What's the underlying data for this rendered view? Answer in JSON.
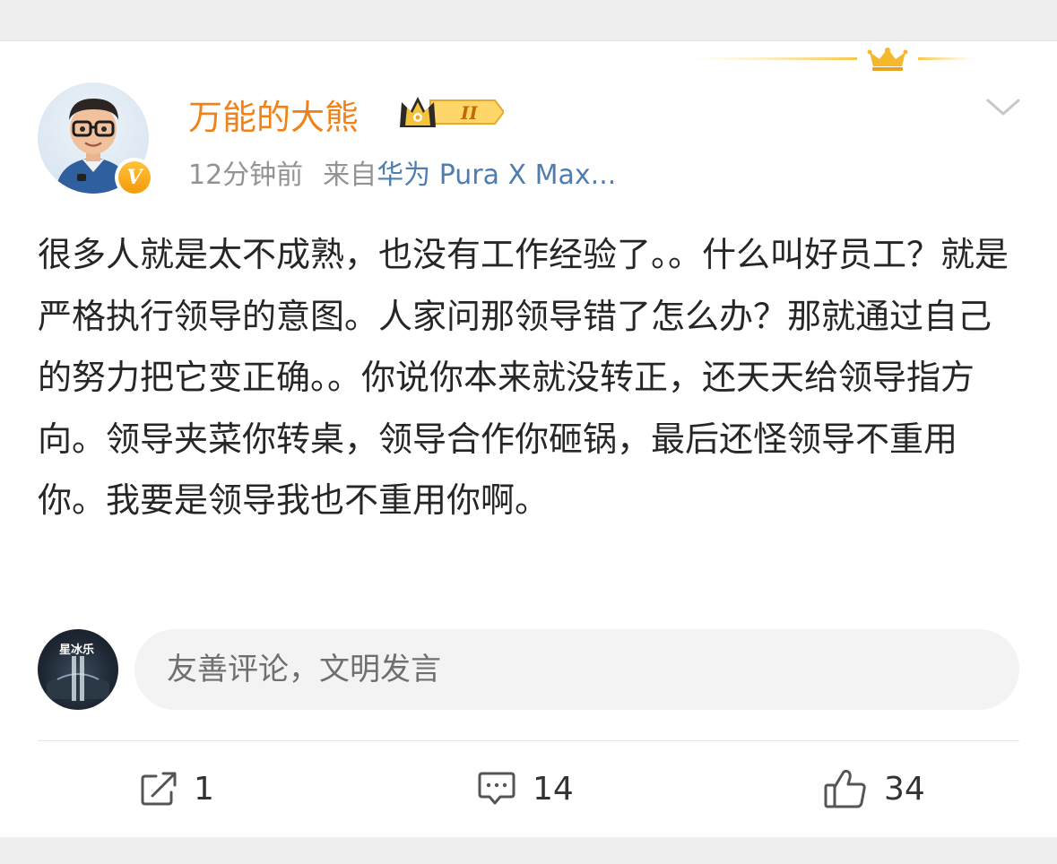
{
  "post": {
    "author": "万能的大熊",
    "level_badge": "II",
    "time": "12分钟前",
    "source_prefix": "来自",
    "device": "华为 Pura X Max...",
    "vip_mark": "V",
    "text": "很多人就是太不成熟，也没有工作经验了。。什么叫好员工？就是严格执行领导的意图。人家问那领导错了怎么办？那就通过自己的努力把它变正确。。你说你本来就没转正，还天天给领导指方向。领导夹菜你转桌，领导合作你砸锅，最后还怪领导不重用你。我要是领导我也不重用你啊。"
  },
  "comment_bar": {
    "placeholder": "友善评论，文明发言",
    "avatar_tag": "星冰乐"
  },
  "actions": {
    "share_count": "1",
    "comment_count": "14",
    "like_count": "34"
  },
  "colors": {
    "username": "#f0821a",
    "device_link": "#507daf",
    "vip_gold": "#f59a0a"
  }
}
